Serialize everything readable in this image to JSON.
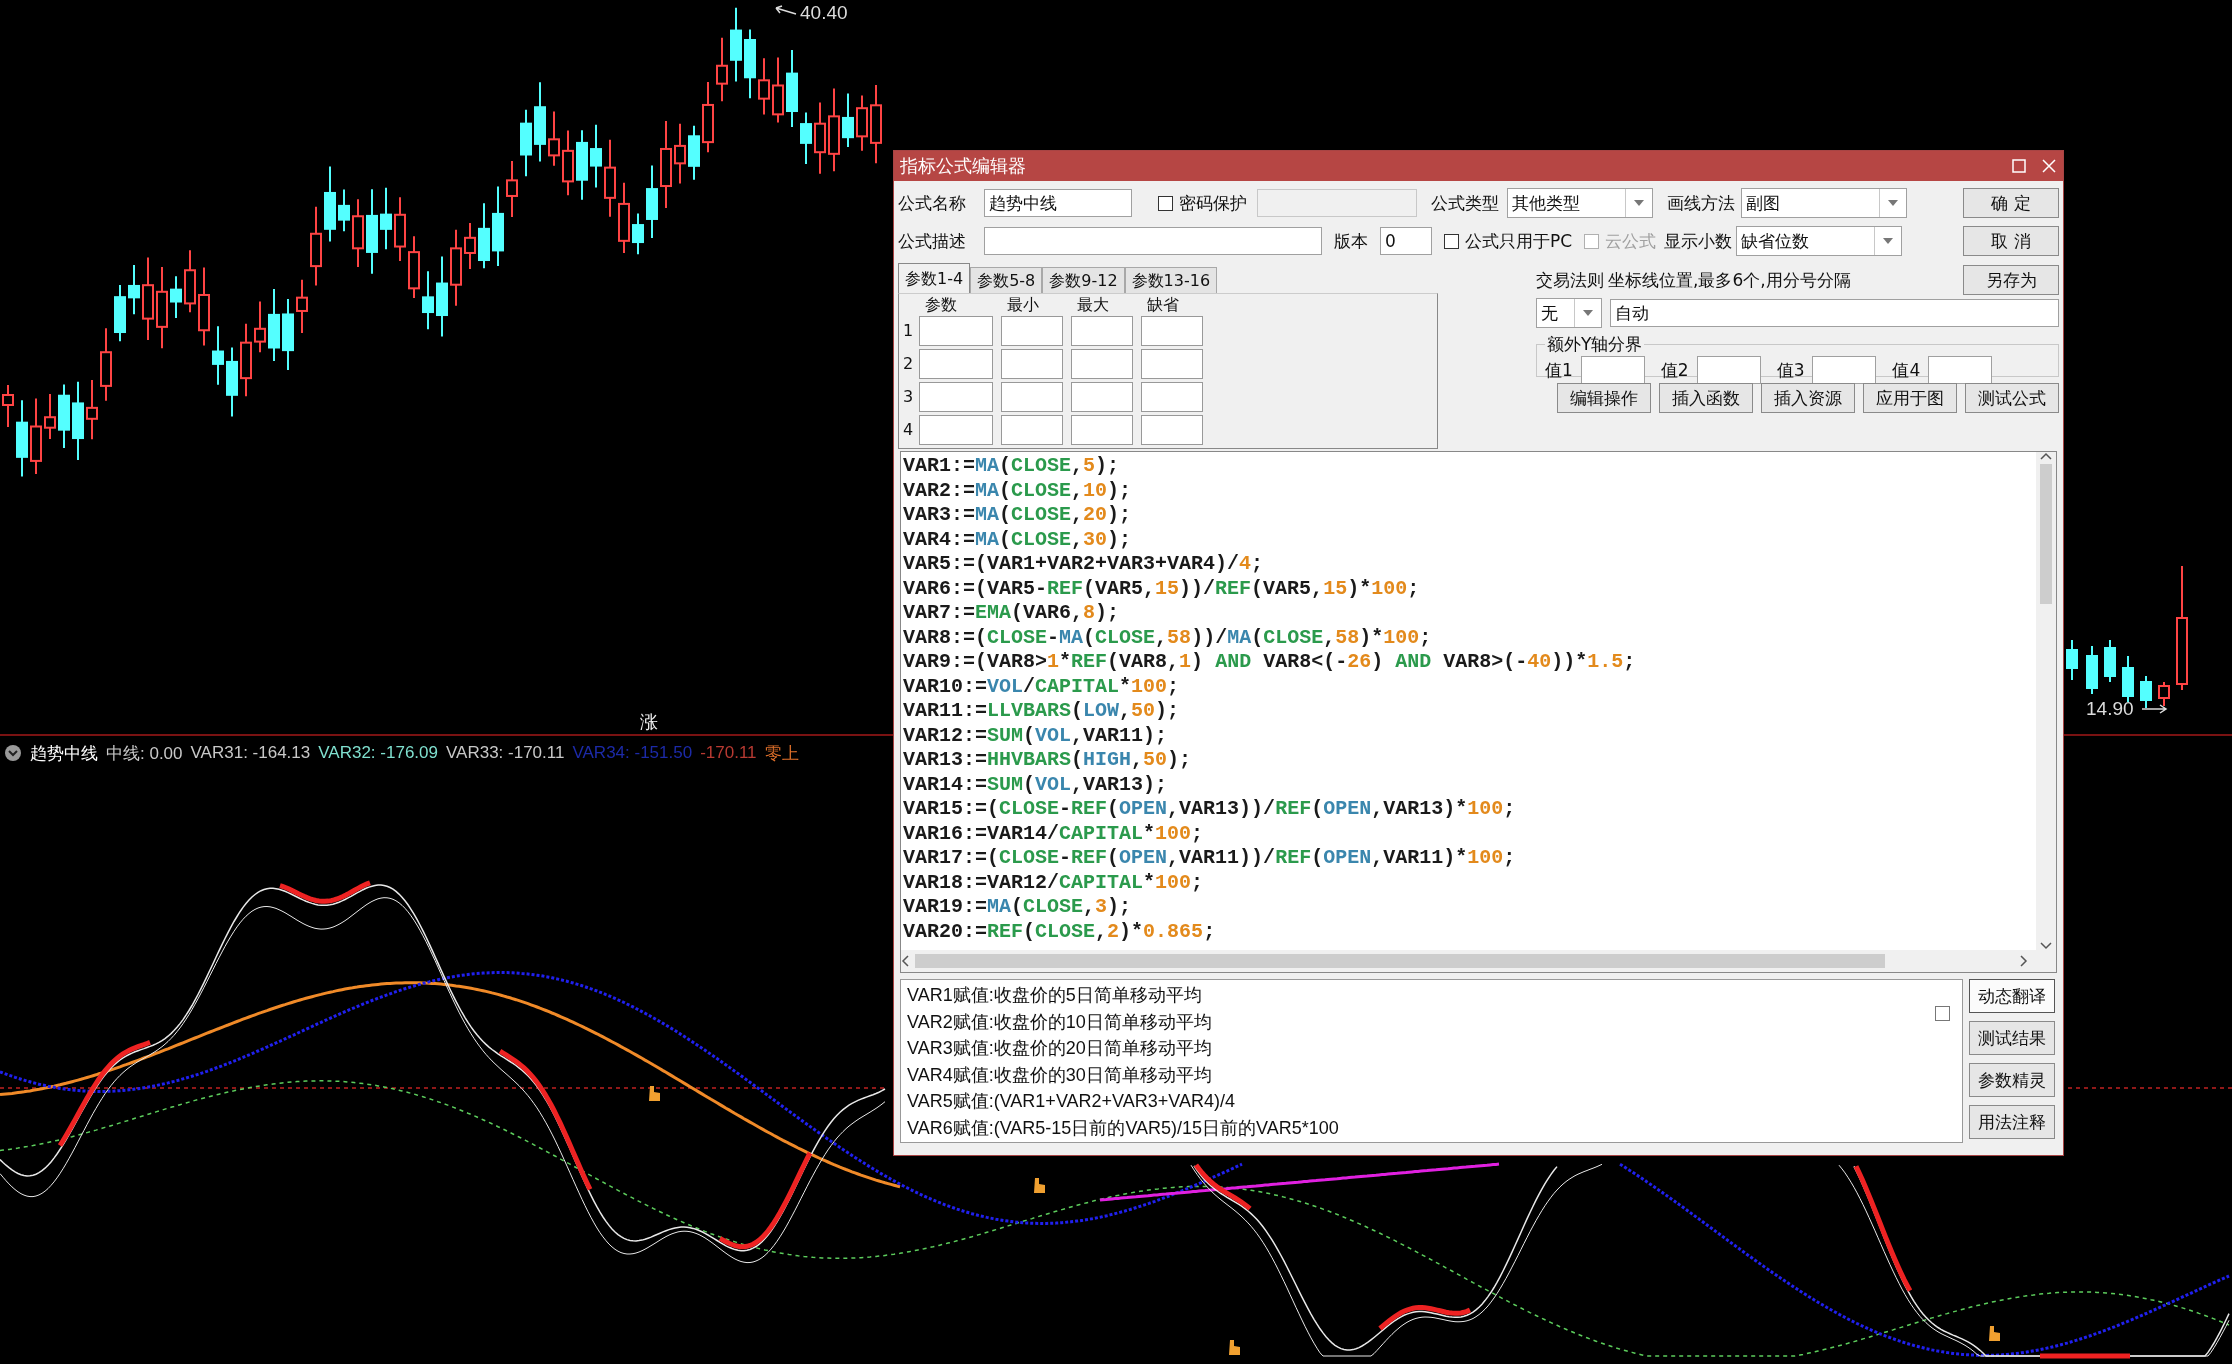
{
  "price_chart": {
    "high_label": "40.40",
    "low_label": "14.90",
    "marker": "涨"
  },
  "indicator": {
    "name": "趋势中线",
    "readouts": [
      {
        "text": "中线: 0.00",
        "color": "#c8c8c8"
      },
      {
        "text": "VAR31: -164.13",
        "color": "#c8c8c8"
      },
      {
        "text": "VAR32: -176.09",
        "color": "#7fe0cf"
      },
      {
        "text": "VAR33: -170.11",
        "color": "#c8c8c8"
      },
      {
        "text": "VAR34: -151.50",
        "color": "#1c2aa8"
      },
      {
        "text": "-170.11",
        "color": "#b83a32"
      },
      {
        "text": "零上",
        "color": "#e0702a"
      }
    ]
  },
  "dialog": {
    "title": "指标公式编辑器",
    "formula_name": {
      "label": "公式名称",
      "value": "趋势中线"
    },
    "password": {
      "label": "密码保护",
      "checked": false
    },
    "formula_type": {
      "label": "公式类型",
      "value": "其他类型"
    },
    "draw_method": {
      "label": "画线方法",
      "value": "副图"
    },
    "description": {
      "label": "公式描述"
    },
    "version": {
      "label": "版本",
      "value": "0"
    },
    "pc_only": {
      "label": "公式只用于PC",
      "checked": false,
      "disabled": false
    },
    "cloud": {
      "label": "云公式",
      "checked": false,
      "disabled": true
    },
    "decimals": {
      "label": "显示小数",
      "value": "缺省位数"
    },
    "side_buttons": [
      "确 定",
      "取 消",
      "另存为"
    ],
    "tabs": [
      {
        "label": "参数1-4",
        "selected": true
      },
      {
        "label": "参数5-8",
        "selected": false
      },
      {
        "label": "参数9-12",
        "selected": false
      },
      {
        "label": "参数13-16",
        "selected": false
      }
    ],
    "param_columns": [
      "参数",
      "最小",
      "最大",
      "缺省"
    ],
    "param_rows": [
      "1",
      "2",
      "3",
      "4"
    ],
    "trade_rule": {
      "label": "交易法则",
      "value": "无"
    },
    "axis_lines": {
      "label": "坐标线位置,最多6个,用分号分隔",
      "value": "自动"
    },
    "y_bounds": {
      "label": "额外Y轴分界",
      "fields": [
        "值1",
        "值2",
        "值3",
        "值4"
      ]
    },
    "action_buttons": [
      "编辑操作",
      "插入函数",
      "插入资源",
      "应用于图",
      "测试公式"
    ],
    "code_lines": [
      [
        {
          "text": "VAR1:=",
          "kind": "plain"
        },
        {
          "text": "MA",
          "kind": "func"
        },
        {
          "text": "(",
          "kind": "plain"
        },
        {
          "text": "CLOSE",
          "kind": "word"
        },
        {
          "text": ",",
          "kind": "plain"
        },
        {
          "text": "5",
          "kind": "num"
        },
        {
          "text": ");",
          "kind": "plain"
        }
      ],
      [
        {
          "text": "VAR2:=",
          "kind": "plain"
        },
        {
          "text": "MA",
          "kind": "func"
        },
        {
          "text": "(",
          "kind": "plain"
        },
        {
          "text": "CLOSE",
          "kind": "word"
        },
        {
          "text": ",",
          "kind": "plain"
        },
        {
          "text": "10",
          "kind": "num"
        },
        {
          "text": ");",
          "kind": "plain"
        }
      ],
      [
        {
          "text": "VAR3:=",
          "kind": "plain"
        },
        {
          "text": "MA",
          "kind": "func"
        },
        {
          "text": "(",
          "kind": "plain"
        },
        {
          "text": "CLOSE",
          "kind": "word"
        },
        {
          "text": ",",
          "kind": "plain"
        },
        {
          "text": "20",
          "kind": "num"
        },
        {
          "text": ");",
          "kind": "plain"
        }
      ],
      [
        {
          "text": "VAR4:=",
          "kind": "plain"
        },
        {
          "text": "MA",
          "kind": "func"
        },
        {
          "text": "(",
          "kind": "plain"
        },
        {
          "text": "CLOSE",
          "kind": "word"
        },
        {
          "text": ",",
          "kind": "plain"
        },
        {
          "text": "30",
          "kind": "num"
        },
        {
          "text": ");",
          "kind": "plain"
        }
      ],
      [
        {
          "text": "VAR5:=(VAR1+VAR2+VAR3+VAR4)/",
          "kind": "plain"
        },
        {
          "text": "4",
          "kind": "num"
        },
        {
          "text": ";",
          "kind": "plain"
        }
      ],
      [
        {
          "text": "VAR6:=(VAR5-",
          "kind": "plain"
        },
        {
          "text": "REF",
          "kind": "word"
        },
        {
          "text": "(VAR5,",
          "kind": "plain"
        },
        {
          "text": "15",
          "kind": "num"
        },
        {
          "text": "))/",
          "kind": "plain"
        },
        {
          "text": "REF",
          "kind": "word"
        },
        {
          "text": "(VAR5,",
          "kind": "plain"
        },
        {
          "text": "15",
          "kind": "num"
        },
        {
          "text": ")*",
          "kind": "plain"
        },
        {
          "text": "100",
          "kind": "num"
        },
        {
          "text": ";",
          "kind": "plain"
        }
      ],
      [
        {
          "text": "VAR7:=",
          "kind": "plain"
        },
        {
          "text": "EMA",
          "kind": "word"
        },
        {
          "text": "(VAR6,",
          "kind": "plain"
        },
        {
          "text": "8",
          "kind": "num"
        },
        {
          "text": ");",
          "kind": "plain"
        }
      ],
      [
        {
          "text": "VAR8:=(",
          "kind": "plain"
        },
        {
          "text": "CLOSE",
          "kind": "word"
        },
        {
          "text": "-",
          "kind": "plain"
        },
        {
          "text": "MA",
          "kind": "func"
        },
        {
          "text": "(",
          "kind": "plain"
        },
        {
          "text": "CLOSE",
          "kind": "word"
        },
        {
          "text": ",",
          "kind": "plain"
        },
        {
          "text": "58",
          "kind": "num"
        },
        {
          "text": "))/",
          "kind": "plain"
        },
        {
          "text": "MA",
          "kind": "func"
        },
        {
          "text": "(",
          "kind": "plain"
        },
        {
          "text": "CLOSE",
          "kind": "word"
        },
        {
          "text": ",",
          "kind": "plain"
        },
        {
          "text": "58",
          "kind": "num"
        },
        {
          "text": ")*",
          "kind": "plain"
        },
        {
          "text": "100",
          "kind": "num"
        },
        {
          "text": ";",
          "kind": "plain"
        }
      ],
      [
        {
          "text": "VAR9:=(VAR8>",
          "kind": "plain"
        },
        {
          "text": "1",
          "kind": "num"
        },
        {
          "text": "*",
          "kind": "plain"
        },
        {
          "text": "REF",
          "kind": "word"
        },
        {
          "text": "(VAR8,",
          "kind": "plain"
        },
        {
          "text": "1",
          "kind": "num"
        },
        {
          "text": ") ",
          "kind": "plain"
        },
        {
          "text": "AND",
          "kind": "word"
        },
        {
          "text": " VAR8<(-",
          "kind": "plain"
        },
        {
          "text": "26",
          "kind": "num"
        },
        {
          "text": ") ",
          "kind": "plain"
        },
        {
          "text": "AND",
          "kind": "word"
        },
        {
          "text": " VAR8>(-",
          "kind": "plain"
        },
        {
          "text": "40",
          "kind": "num"
        },
        {
          "text": "))*",
          "kind": "plain"
        },
        {
          "text": "1.5",
          "kind": "num"
        },
        {
          "text": ";",
          "kind": "plain"
        }
      ],
      [
        {
          "text": "VAR10:=",
          "kind": "plain"
        },
        {
          "text": "VOL",
          "kind": "func"
        },
        {
          "text": "/",
          "kind": "plain"
        },
        {
          "text": "CAPITAL",
          "kind": "word"
        },
        {
          "text": "*",
          "kind": "plain"
        },
        {
          "text": "100",
          "kind": "num"
        },
        {
          "text": ";",
          "kind": "plain"
        }
      ],
      [
        {
          "text": "VAR11:=",
          "kind": "plain"
        },
        {
          "text": "LLVBARS",
          "kind": "word"
        },
        {
          "text": "(",
          "kind": "plain"
        },
        {
          "text": "LOW",
          "kind": "func"
        },
        {
          "text": ",",
          "kind": "plain"
        },
        {
          "text": "50",
          "kind": "num"
        },
        {
          "text": ");",
          "kind": "plain"
        }
      ],
      [
        {
          "text": "VAR12:=",
          "kind": "plain"
        },
        {
          "text": "SUM",
          "kind": "word"
        },
        {
          "text": "(",
          "kind": "plain"
        },
        {
          "text": "VOL",
          "kind": "func"
        },
        {
          "text": ",VAR11);",
          "kind": "plain"
        }
      ],
      [
        {
          "text": "VAR13:=",
          "kind": "plain"
        },
        {
          "text": "HHVBARS",
          "kind": "word"
        },
        {
          "text": "(",
          "kind": "plain"
        },
        {
          "text": "HIGH",
          "kind": "func"
        },
        {
          "text": ",",
          "kind": "plain"
        },
        {
          "text": "50",
          "kind": "num"
        },
        {
          "text": ");",
          "kind": "plain"
        }
      ],
      [
        {
          "text": "VAR14:=",
          "kind": "plain"
        },
        {
          "text": "SUM",
          "kind": "word"
        },
        {
          "text": "(",
          "kind": "plain"
        },
        {
          "text": "VOL",
          "kind": "func"
        },
        {
          "text": ",VAR13);",
          "kind": "plain"
        }
      ],
      [
        {
          "text": "VAR15:=(",
          "kind": "plain"
        },
        {
          "text": "CLOSE",
          "kind": "word"
        },
        {
          "text": "-",
          "kind": "plain"
        },
        {
          "text": "REF",
          "kind": "word"
        },
        {
          "text": "(",
          "kind": "plain"
        },
        {
          "text": "OPEN",
          "kind": "func"
        },
        {
          "text": ",VAR13))/",
          "kind": "plain"
        },
        {
          "text": "REF",
          "kind": "word"
        },
        {
          "text": "(",
          "kind": "plain"
        },
        {
          "text": "OPEN",
          "kind": "func"
        },
        {
          "text": ",VAR13)*",
          "kind": "plain"
        },
        {
          "text": "100",
          "kind": "num"
        },
        {
          "text": ";",
          "kind": "plain"
        }
      ],
      [
        {
          "text": "VAR16:=VAR14/",
          "kind": "plain"
        },
        {
          "text": "CAPITAL",
          "kind": "word"
        },
        {
          "text": "*",
          "kind": "plain"
        },
        {
          "text": "100",
          "kind": "num"
        },
        {
          "text": ";",
          "kind": "plain"
        }
      ],
      [
        {
          "text": "VAR17:=(",
          "kind": "plain"
        },
        {
          "text": "CLOSE",
          "kind": "word"
        },
        {
          "text": "-",
          "kind": "plain"
        },
        {
          "text": "REF",
          "kind": "word"
        },
        {
          "text": "(",
          "kind": "plain"
        },
        {
          "text": "OPEN",
          "kind": "func"
        },
        {
          "text": ",VAR11))/",
          "kind": "plain"
        },
        {
          "text": "REF",
          "kind": "word"
        },
        {
          "text": "(",
          "kind": "plain"
        },
        {
          "text": "OPEN",
          "kind": "func"
        },
        {
          "text": ",VAR11)*",
          "kind": "plain"
        },
        {
          "text": "100",
          "kind": "num"
        },
        {
          "text": ";",
          "kind": "plain"
        }
      ],
      [
        {
          "text": "VAR18:=VAR12/",
          "kind": "plain"
        },
        {
          "text": "CAPITAL",
          "kind": "word"
        },
        {
          "text": "*",
          "kind": "plain"
        },
        {
          "text": "100",
          "kind": "num"
        },
        {
          "text": ";",
          "kind": "plain"
        }
      ],
      [
        {
          "text": "VAR19:=",
          "kind": "plain"
        },
        {
          "text": "MA",
          "kind": "func"
        },
        {
          "text": "(",
          "kind": "plain"
        },
        {
          "text": "CLOSE",
          "kind": "word"
        },
        {
          "text": ",",
          "kind": "plain"
        },
        {
          "text": "3",
          "kind": "num"
        },
        {
          "text": ");",
          "kind": "plain"
        }
      ],
      [
        {
          "text": "VAR20:=",
          "kind": "plain"
        },
        {
          "text": "REF",
          "kind": "word"
        },
        {
          "text": "(",
          "kind": "plain"
        },
        {
          "text": "CLOSE",
          "kind": "word"
        },
        {
          "text": ",",
          "kind": "plain"
        },
        {
          "text": "2",
          "kind": "num"
        },
        {
          "text": ")*",
          "kind": "plain"
        },
        {
          "text": "0.865",
          "kind": "num"
        },
        {
          "text": ";",
          "kind": "plain"
        }
      ]
    ],
    "notes": [
      "VAR1赋值:收盘价的5日简单移动平均",
      "VAR2赋值:收盘价的10日简单移动平均",
      "VAR3赋值:收盘价的20日简单移动平均",
      "VAR4赋值:收盘价的30日简单移动平均",
      "VAR5赋值:(VAR1+VAR2+VAR3+VAR4)/4",
      "VAR6赋值:(VAR5-15日前的VAR5)/15日前的VAR5*100"
    ],
    "notes_checkbox": {
      "checked": false
    },
    "note_buttons": [
      {
        "label": "动态翻译",
        "selected": true
      },
      {
        "label": "测试结果",
        "selected": false
      },
      {
        "label": "参数精灵",
        "selected": false
      },
      {
        "label": "用法注释",
        "selected": false
      }
    ]
  }
}
